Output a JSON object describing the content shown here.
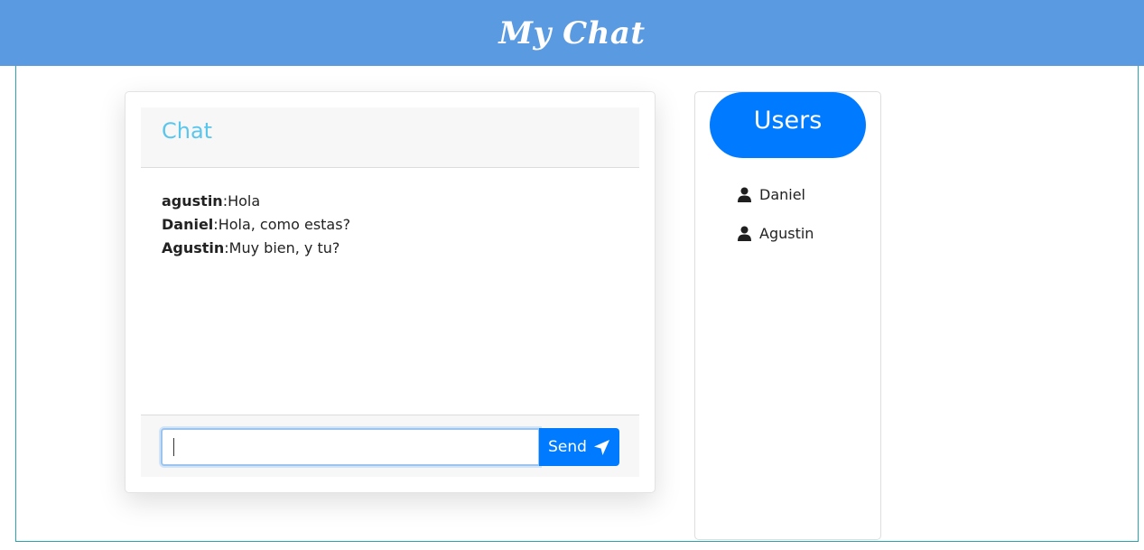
{
  "header": {
    "title": "My Chat"
  },
  "chat": {
    "title": "Chat",
    "messages": [
      {
        "author": "agustin",
        "separator": ":",
        "text": "Hola"
      },
      {
        "author": "Daniel",
        "separator": ":",
        "text": "Hola, como estas?"
      },
      {
        "author": "Agustin",
        "separator": ":",
        "text": "Muy bien, y tu?"
      }
    ],
    "input": {
      "value": "",
      "placeholder": ""
    },
    "send_label": "Send",
    "send_icon": "paper-plane-icon"
  },
  "users": {
    "title": "Users",
    "items": [
      {
        "name": "Daniel",
        "icon": "user-icon"
      },
      {
        "name": "Agustin",
        "icon": "user-icon"
      }
    ]
  },
  "colors": {
    "header_bg": "#5a9ae0",
    "primary": "#007bff",
    "chat_title": "#5bc6ec",
    "frame_border": "#2aa5b0"
  }
}
